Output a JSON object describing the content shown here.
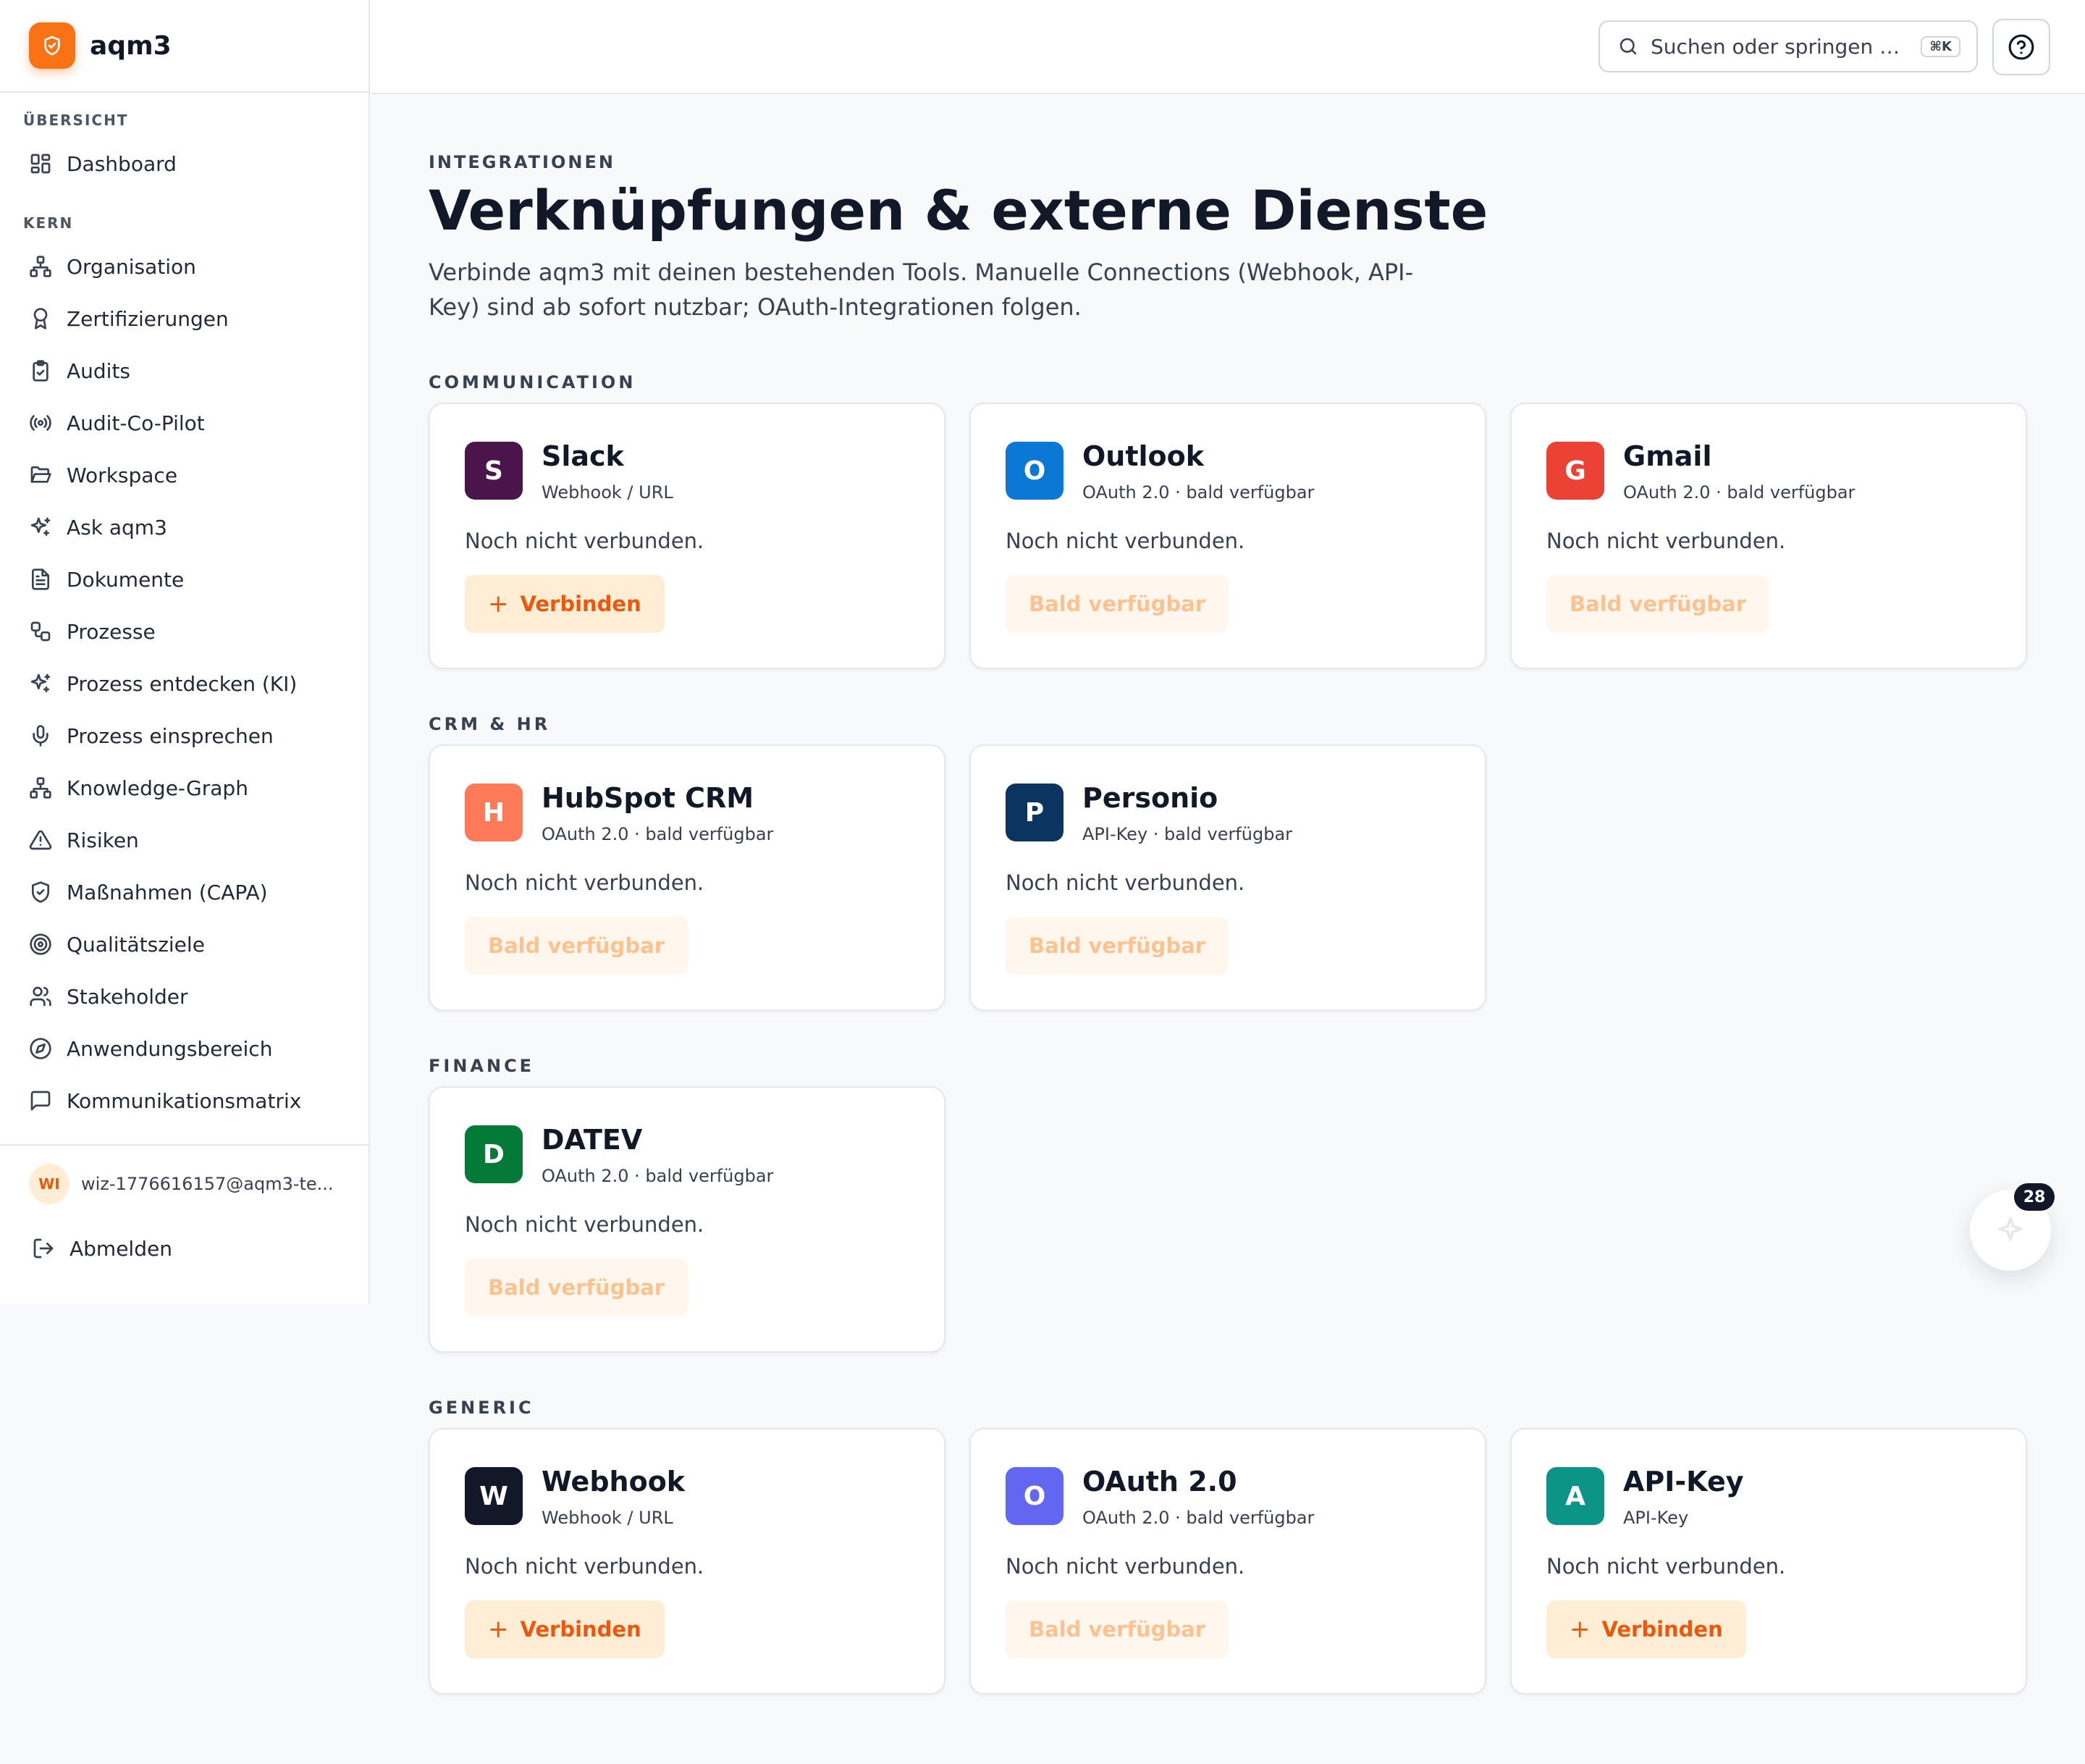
{
  "app": {
    "name": "aqm3"
  },
  "search": {
    "placeholder": "Suchen oder springen …",
    "shortcut": "⌘K"
  },
  "sidebar": {
    "sections": [
      {
        "heading": "ÜBERSICHT",
        "items": [
          {
            "label": "Dashboard",
            "icon": "dashboard-icon"
          }
        ]
      },
      {
        "heading": "KERN",
        "items": [
          {
            "label": "Organisation",
            "icon": "org-tree-icon"
          },
          {
            "label": "Zertifizierungen",
            "icon": "award-icon"
          },
          {
            "label": "Audits",
            "icon": "clipboard-check-icon"
          },
          {
            "label": "Audit-Co-Pilot",
            "icon": "radio-icon"
          },
          {
            "label": "Workspace",
            "icon": "folder-open-icon"
          },
          {
            "label": "Ask aqm3",
            "icon": "sparkles-icon"
          },
          {
            "label": "Dokumente",
            "icon": "file-text-icon"
          },
          {
            "label": "Prozesse",
            "icon": "workflow-icon"
          },
          {
            "label": "Prozess entdecken (KI)",
            "icon": "sparkles-icon"
          },
          {
            "label": "Prozess einsprechen",
            "icon": "microphone-icon"
          },
          {
            "label": "Knowledge-Graph",
            "icon": "network-icon"
          },
          {
            "label": "Risiken",
            "icon": "warning-triangle-icon"
          },
          {
            "label": "Maßnahmen (CAPA)",
            "icon": "shield-check-icon"
          },
          {
            "label": "Qualitätsziele",
            "icon": "target-icon"
          },
          {
            "label": "Stakeholder",
            "icon": "users-icon"
          },
          {
            "label": "Anwendungsbereich",
            "icon": "compass-icon"
          },
          {
            "label": "Kommunikationsmatrix",
            "icon": "message-square-icon"
          }
        ]
      }
    ],
    "user": {
      "initials": "WI",
      "email": "wiz-1776616157@aqm3-te..."
    },
    "logout_label": "Abmelden"
  },
  "main": {
    "eyebrow": "INTEGRATIONEN",
    "title": "Verknüpfungen & externe Dienste",
    "intro": "Verbinde aqm3 mit deinen bestehenden Tools. Manuelle Connections (Webhook, API-Key) sind ab sofort nutzbar; OAuth-Integrationen folgen.",
    "groups": [
      {
        "heading": "COMMUNICATION",
        "cards": [
          {
            "letter": "S",
            "name": "Slack",
            "subtitle": "Webhook / URL",
            "status": "Noch nicht verbunden.",
            "button": "Verbinden",
            "available": true,
            "color": "#4a154b"
          },
          {
            "letter": "O",
            "name": "Outlook",
            "subtitle": "OAuth 2.0 · bald verfügbar",
            "status": "Noch nicht verbunden.",
            "button": "Bald verfügbar",
            "available": false,
            "color": "#0a78d4"
          },
          {
            "letter": "G",
            "name": "Gmail",
            "subtitle": "OAuth 2.0 · bald verfügbar",
            "status": "Noch nicht verbunden.",
            "button": "Bald verfügbar",
            "available": false,
            "color": "#ea4335"
          }
        ]
      },
      {
        "heading": "CRM & HR",
        "cards": [
          {
            "letter": "H",
            "name": "HubSpot CRM",
            "subtitle": "OAuth 2.0 · bald verfügbar",
            "status": "Noch nicht verbunden.",
            "button": "Bald verfügbar",
            "available": false,
            "color": "#ff7a59"
          },
          {
            "letter": "P",
            "name": "Personio",
            "subtitle": "API-Key · bald verfügbar",
            "status": "Noch nicht verbunden.",
            "button": "Bald verfügbar",
            "available": false,
            "color": "#0b3460"
          }
        ]
      },
      {
        "heading": "FINANCE",
        "cards": [
          {
            "letter": "D",
            "name": "DATEV",
            "subtitle": "OAuth 2.0 · bald verfügbar",
            "status": "Noch nicht verbunden.",
            "button": "Bald verfügbar",
            "available": false,
            "color": "#047a38"
          }
        ]
      },
      {
        "heading": "GENERIC",
        "cards": [
          {
            "letter": "W",
            "name": "Webhook",
            "subtitle": "Webhook / URL",
            "status": "Noch nicht verbunden.",
            "button": "Verbinden",
            "available": true,
            "color": "#111827"
          },
          {
            "letter": "O",
            "name": "OAuth 2.0",
            "subtitle": "OAuth 2.0 · bald verfügbar",
            "status": "Noch nicht verbunden.",
            "button": "Bald verfügbar",
            "available": false,
            "color": "#6366f1"
          },
          {
            "letter": "A",
            "name": "API-Key",
            "subtitle": "API-Key",
            "status": "Noch nicht verbunden.",
            "button": "Verbinden",
            "available": true,
            "color": "#0d9488"
          }
        ]
      }
    ]
  },
  "assistant": {
    "badge_count": "28"
  }
}
